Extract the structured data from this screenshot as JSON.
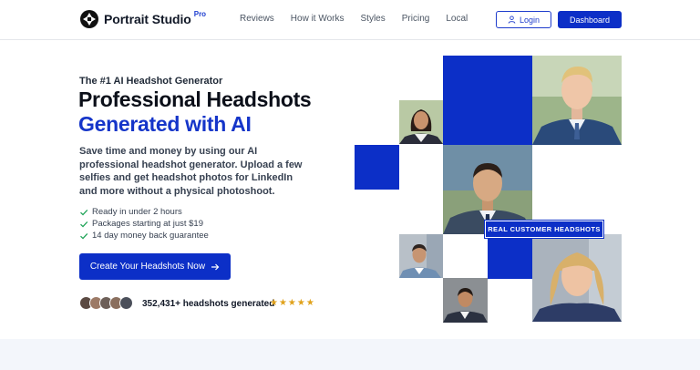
{
  "header": {
    "brand": "Portrait Studio",
    "brand_badge": "Pro",
    "nav": [
      "Reviews",
      "How it Works",
      "Styles",
      "Pricing",
      "Local"
    ],
    "login_label": "Login",
    "dashboard_label": "Dashboard"
  },
  "hero": {
    "eyebrow": "The #1 AI Headshot Generator",
    "title_line1": "Professional Headshots",
    "title_line2": "Generated with AI",
    "lead": "Save time and money by using our AI professional headshot generator. Upload a few selfies and get headshot photos for LinkedIn and more without a physical photoshoot.",
    "checks": [
      "Ready in under 2 hours",
      "Packages starting at just $19",
      "14 day money back guarantee"
    ],
    "cta_label": "Create Your Headshots Now",
    "social_proof": "352,431+ headshots generated",
    "stars": "★★★★★",
    "rating": 5
  },
  "collage": {
    "badge": "REAL CUSTOMER HEADSHOTS"
  },
  "colors": {
    "accent": "#0c2fc7",
    "heading_blue": "#1535c9",
    "check_green": "#22a55a",
    "star": "#e0a21c"
  }
}
